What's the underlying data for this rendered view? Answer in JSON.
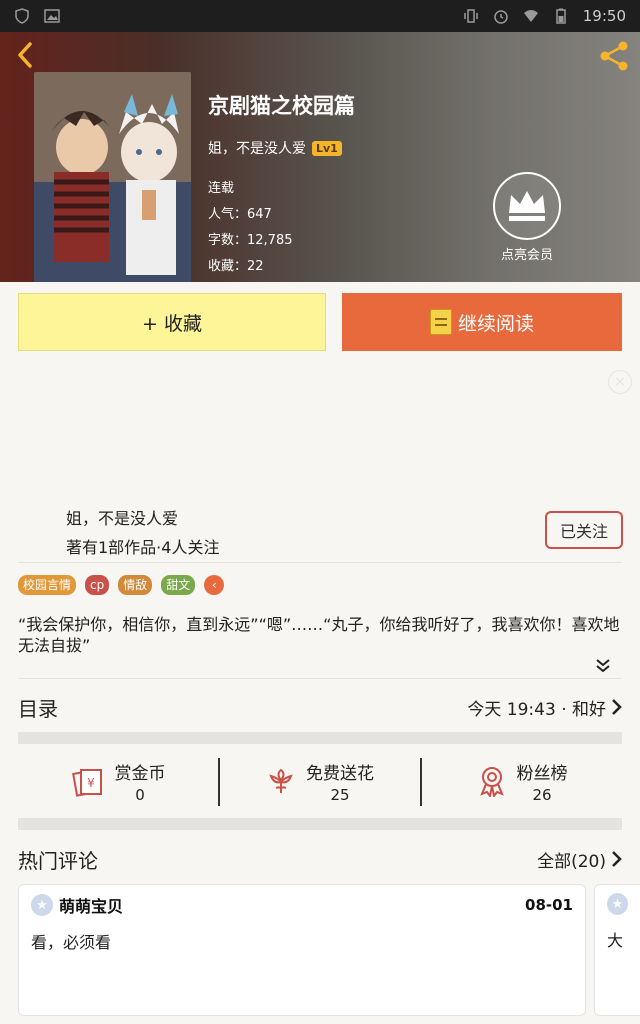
{
  "status_bar": {
    "time": "19:50"
  },
  "book": {
    "title": "京剧猫之校园篇",
    "author": "姐，不是没人爱",
    "level": "Lv1",
    "status": "连载",
    "popularity": "人气：647",
    "word_count": "字数：12,785",
    "favorites": "收藏：22"
  },
  "vip": {
    "label": "点亮会员"
  },
  "actions": {
    "collect_label": "+ 收藏",
    "read_label": "继续阅读"
  },
  "author_info": {
    "name": "姐，不是没人爱",
    "stats": "著有1部作品·4人关注",
    "follow_label": "已关注"
  },
  "tags": [
    {
      "label": "校园言情",
      "color": "#e09838"
    },
    {
      "label": "cp",
      "color": "#c9514a"
    },
    {
      "label": "情敌",
      "color": "#d28a3a"
    },
    {
      "label": "甜文",
      "color": "#7aa84a"
    }
  ],
  "description": "“我会保护你，相信你，直到永远”“嗯”……“丸子，你给我听好了，我喜欢你！喜欢地无法自拔”",
  "toc": {
    "title": "目录",
    "latest": "今天 19:43 · 和好"
  },
  "stats": [
    {
      "label": "赏金币",
      "value": "0",
      "icon": "coin-envelope-icon"
    },
    {
      "label": "免费送花",
      "value": "25",
      "icon": "flower-icon"
    },
    {
      "label": "粉丝榜",
      "value": "26",
      "icon": "medal-icon"
    }
  ],
  "hot_comments": {
    "title": "热门评论",
    "all_label": "全部(20)",
    "items": [
      {
        "user": "萌萌宝贝",
        "date": "08-01",
        "text": "看，必须看"
      },
      {
        "user": "",
        "date": "",
        "text": "大"
      }
    ]
  },
  "colors": {
    "accent": "#e8693c",
    "collect_bg": "#fdf598",
    "follow_border": "#c9514a"
  }
}
